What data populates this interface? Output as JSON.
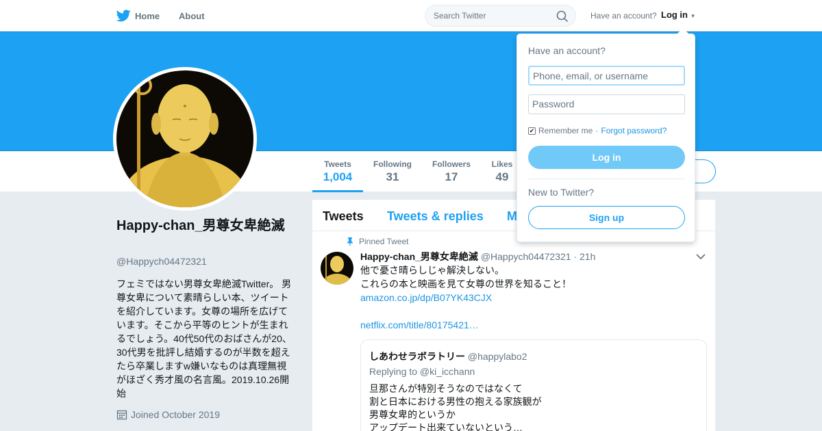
{
  "topbar": {
    "home_label": "Home",
    "about_label": "About",
    "search_placeholder": "Search Twitter",
    "have_account": "Have an account?",
    "login_label": "Log in"
  },
  "profile": {
    "name": "Happy-chan_男尊女卑絶滅",
    "handle": "@Happych04472321",
    "bio": "フェミではない男尊女卑絶滅Twitter。 男尊女卑について素晴らしい本、ツイートを紹介しています。女尊の場所を広げています。そこから平等のヒントが生まれるでしょう。40代50代のおばさんが20、30代男を批評し結婚するのが半数を超えたら卒業しますw嫌いなものは真理無視がほざく秀才風の名言風。2019.10.26開始",
    "joined": "Joined October 2019"
  },
  "stats": [
    {
      "label": "Tweets",
      "value": "1,004"
    },
    {
      "label": "Following",
      "value": "31"
    },
    {
      "label": "Followers",
      "value": "17"
    },
    {
      "label": "Likes",
      "value": "49"
    }
  ],
  "timeline": {
    "tabs": [
      "Tweets",
      "Tweets & replies",
      "M"
    ],
    "tweet": {
      "pinned": "Pinned Tweet",
      "name": "Happy-chan_男尊女卑絶滅",
      "handle_time": "@Happych04472321 · 21h",
      "lines": [
        "他で憂さ晴らしじゃ解決しない。",
        "これらの本と映画を見て女尊の世界を知ること！"
      ],
      "link1": "amazon.co.jp/dp/B07YK43CJX",
      "link2": "netflix.com/title/80175421…",
      "quote": {
        "name": "しあわせラボラトリー",
        "handle": "@happylabo2",
        "replying": "Replying to @ki_icchann",
        "lines": [
          "旦那さんが特別そうなのではなくて",
          "割と日本における男性の抱える家族観が",
          "男尊女卑的というか",
          "アップデート出来ていないという…"
        ]
      }
    }
  },
  "login_dropdown": {
    "title": "Have an account?",
    "username_placeholder": "Phone, email, or username",
    "password_placeholder": "Password",
    "remember": "Remember me",
    "separator": "·",
    "forgot": "Forgot password?",
    "login_button": "Log in",
    "new_to_twitter": "New to Twitter?",
    "signup_button": "Sign up"
  },
  "colors": {
    "brand": "#1da1f2",
    "link": "#1b95e0",
    "banner": "#1da1f2"
  }
}
